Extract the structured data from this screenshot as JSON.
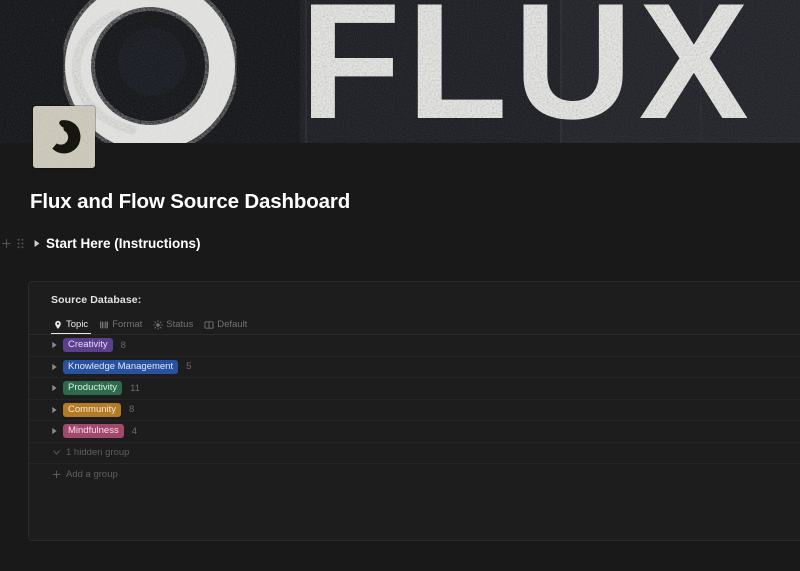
{
  "cover": {
    "name": "flux-and-flow-cover-banner",
    "text": "FLUX &",
    "alt": "Grunge black and white painted enso circle with large distressed FLUX & lettering",
    "bg_dark": "#14161c",
    "bg_paint": "#f2f2ef"
  },
  "page_icon": {
    "name": "enso-spiral-icon",
    "bg": "#cfcabb",
    "stroke": "#17150f"
  },
  "page": {
    "title": "Flux and Flow Source Dashboard"
  },
  "gutter": {
    "add_label": "+",
    "drag_label": "⠿"
  },
  "toggle_block": {
    "label": "Start Here (Instructions)",
    "collapsed": true
  },
  "database": {
    "title": "Source Database:",
    "tabs": [
      {
        "label": "Topic",
        "icon": "map-pin-icon",
        "active": true
      },
      {
        "label": "Format",
        "icon": "book-icon",
        "active": false
      },
      {
        "label": "Status",
        "icon": "sun-icon",
        "active": false
      },
      {
        "label": "Default",
        "icon": "columns-icon",
        "active": false
      }
    ],
    "groups": [
      {
        "label": "Creativity",
        "count": "8",
        "bg": "#5b3f8e",
        "fg": "#e6dcf7"
      },
      {
        "label": "Knowledge Management",
        "count": "5",
        "bg": "#28529e",
        "fg": "#dce7fb"
      },
      {
        "label": "Productivity",
        "count": "11",
        "bg": "#2d6a4b",
        "fg": "#d6f0e2"
      },
      {
        "label": "Community",
        "count": "8",
        "bg": "#b57a25",
        "fg": "#f7e9d2"
      },
      {
        "label": "Mindfulness",
        "count": "4",
        "bg": "#a04a6b",
        "fg": "#fbdbe7"
      }
    ],
    "hidden_group_label": "1 hidden group",
    "add_group_label": "Add a group"
  }
}
